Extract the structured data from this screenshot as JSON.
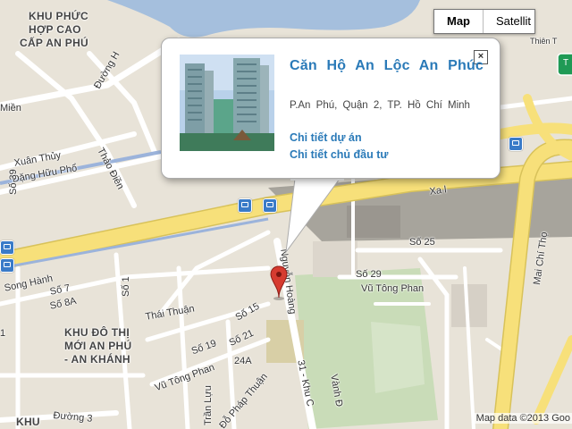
{
  "map_type_control": {
    "map_label": "Map",
    "satellite_label": "Satellit",
    "active": "Map"
  },
  "info_window": {
    "title": "Căn Hộ An Lộc An Phúc",
    "address": "P.An Phú, Quận 2, TP. Hồ Chí Minh",
    "links": [
      "Chi tiết dự án",
      "Chi tiết chủ đầu tư"
    ],
    "close_symbol": "×"
  },
  "attribution": "Map data ©2013 Goo",
  "area_labels": {
    "khu_phuc_hop": [
      "KHU PHỨC",
      "HỢP CAO",
      "CẤP AN PHÚ"
    ],
    "khu_do_thi": [
      "KHU ĐÔ THỊ",
      "MỚI AN PHÚ",
      "- AN KHÁNH"
    ],
    "khu_bottom": "KHU"
  },
  "street_labels": {
    "duong_h": "Đường H",
    "mien": "Miền",
    "xuan_thuy": "Xuân Thủy",
    "dang_huu_pho": "Đặng Hữu Phổ",
    "thao_dien": "Thảo Điền",
    "so_39": "Số 39",
    "song_hanh": "Song Hành",
    "so_7": "Số 7",
    "so_8a": "Số 8A",
    "so_1_left": "Số 1",
    "thai_thuan": "Thái Thuận",
    "so_15": "Số 15",
    "so_19": "Số 19",
    "so_21": "Số 21",
    "vu_tong_phan_left": "Vũ Tông Phan",
    "so_24a": "24A",
    "do_phap_thuan": "Đỗ Pháp Thuận",
    "tran_luu": "Trần Lựu",
    "duong_3": "Đường 3",
    "nguyen_hoang": "Nguyễn Hoàng",
    "so_31_khu_c": "31 - Khu C",
    "vanh_dai": "Vành Đ",
    "so_25": "Số 25",
    "so_29": "Số 29",
    "vu_tong_phan_right": "Vũ Tông Phan",
    "mai_chi_tho": "Mai Chí Thọ",
    "xa_lo": "Xa l",
    "thien_to": "Thiên T",
    "edge_1": "1",
    "edge_t": "T"
  },
  "colors": {
    "land": "#e8e3d8",
    "water": "#a5bfdd",
    "park": "#c9dcb8",
    "highway": "#f7e07a",
    "link": "#2a7ab8",
    "bus_stop": "#3a7bc8",
    "marker": "#d63b30"
  },
  "icons": [
    "close-icon",
    "bus-stop-icon",
    "map-marker-icon",
    "highway-shield-icon"
  ]
}
